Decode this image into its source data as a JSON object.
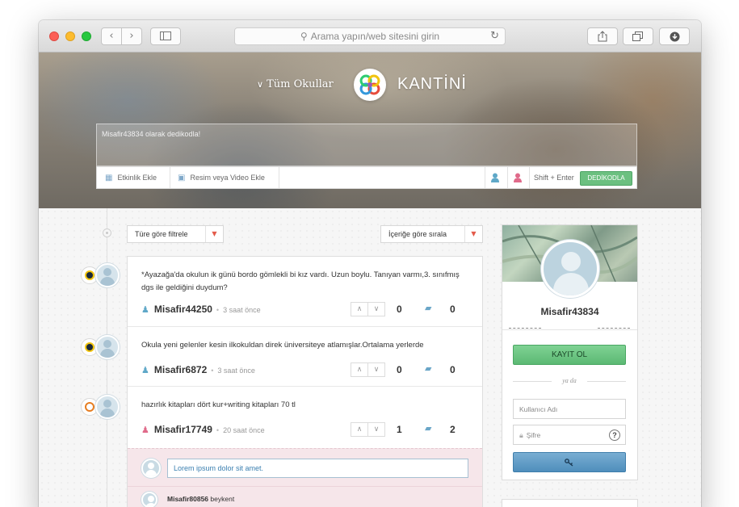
{
  "browser": {
    "address_placeholder": "Arama yapın/web sitesini girin",
    "icons": [
      "back-arrow-icon",
      "forward-arrow-icon",
      "sidebar-icon",
      "search-icon",
      "reload-icon",
      "share-icon",
      "tabs-icon",
      "download-icon"
    ]
  },
  "header": {
    "nav_label": "Tüm Okullar",
    "brand": "KANTİNİ",
    "logo_colors": [
      "#e74c3c",
      "#3498db",
      "#2ecc71",
      "#f1c40f",
      "#9b59b6"
    ]
  },
  "composer": {
    "placeholder": "Misafir43834 olarak dedikodla!",
    "add_event": "Etkinlik Ekle",
    "add_media": "Resim veya Video Ekle",
    "shortcut": "Shift + Enter",
    "submit": "DEDİKODLA"
  },
  "filters": {
    "type_filter": "Türe göre filtrele",
    "sort": "İçeriğe göre sırala"
  },
  "posts": [
    {
      "text": "*Ayazağa'da okulun ik günü bordo gömlekli bi kız vardı. Uzun boylu. Tanıyan varmı,3. sınıfmış dgs ile geldiğini duydum?",
      "user": "Misafir44250",
      "time": "3 saat önce",
      "score": "0",
      "comments": "0",
      "gender_color": "#5fa8c8"
    },
    {
      "text": "Okula yeni gelenler kesin ilkokuldan direk üniversiteye atlamışlar.Ortalama yerlerde",
      "user": "Misafir6872",
      "time": "3 saat önce",
      "score": "0",
      "comments": "0",
      "gender_color": "#5fa8c8"
    },
    {
      "text": "hazırlık kitapları dört kur+writing kitapları 70 tl",
      "user": "Misafir17749",
      "time": "20 saat önce",
      "score": "1",
      "comments": "2",
      "gender_color": "#e06a8a"
    }
  ],
  "comment_box": {
    "value": "Lorem ipsum dolor sit amet.",
    "reply_user": "Misafir80856",
    "reply_text": "beykent"
  },
  "sidebar": {
    "username": "Misafir43834",
    "signup": "KAYIT OL",
    "or": "ya da",
    "username_placeholder": "Kullanıcı Adı",
    "password_placeholder": "Şifre",
    "help": "?",
    "login_icon": "key-icon"
  },
  "colors": {
    "accent_green": "#6cc080",
    "accent_blue": "#5c98c4",
    "caret_red": "#e35a4a"
  }
}
